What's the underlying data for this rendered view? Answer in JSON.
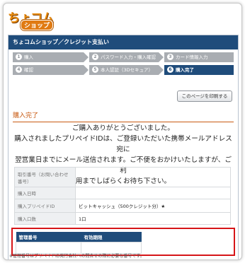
{
  "logo": {
    "main": "ちょコム",
    "sub": "ショップ"
  },
  "page": {
    "title_bar": "ちょコムショップ／クレジット支払い",
    "steps": [
      {
        "num": "1",
        "label": "購入",
        "active": false
      },
      {
        "num": "2",
        "label": "パスワード入力・購入確認",
        "active": false
      },
      {
        "num": "3",
        "label": "カード情報入力",
        "active": false
      },
      {
        "num": "4",
        "label": "確認",
        "active": false
      },
      {
        "num": "5",
        "label": "本人認証（3Dセキュア）",
        "active": false
      },
      {
        "num": "6",
        "label": "購入完了",
        "active": true
      }
    ],
    "print_button": "このページを印刷する",
    "section_title": "購入完了",
    "message_lines": [
      "ご購入ありがとうございました。",
      "購入されましたプリペイドIDは、ご登録いただいた携帯メールアドレス宛に",
      "翌営業日までにメール送信されます。ご不便をおかけいたしますが、ご利",
      "用までしばらくお待ち下さい。"
    ],
    "info_rows": [
      {
        "label": "取引番号（お問い合わせ番号）",
        "value": ""
      },
      {
        "label": "購入日時",
        "value": ""
      },
      {
        "label": "購入プリペイドID",
        "value": "ビットキャッシュ（500クレジット分）★"
      },
      {
        "label": "購入口数",
        "value": "1口"
      }
    ],
    "mgmt_headers": [
      "管理番号",
      "有効期限"
    ],
    "note": "※管理番号はプリペイドID発行会社への問合せの際に必要な番号です。"
  },
  "colors": {
    "navy": "#1f4c7b",
    "orange": "#c85a12",
    "highlight": "#d61518",
    "step_gray": "#a9adb2"
  }
}
